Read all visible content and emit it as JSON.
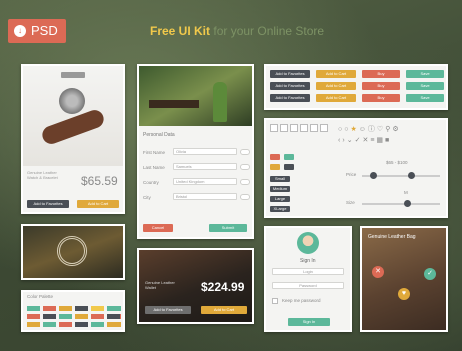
{
  "badge": {
    "label": "PSD"
  },
  "header": {
    "title_strong": "Free UI Kit",
    "title_rest": "for your Online Store"
  },
  "product_card": {
    "price": "$65.59",
    "caption": "Genuine Leather\nWatch & Bracelet",
    "add_to_cart": "Add to Favorites",
    "buy": "Add to Cart"
  },
  "form_card": {
    "section": "Personal Data",
    "rows": [
      {
        "label": "First Name",
        "value": "Olivia"
      },
      {
        "label": "Last Name",
        "value": "Samuels"
      },
      {
        "label": "Country",
        "value": "United Kingdom"
      },
      {
        "label": "City",
        "value": "Bristol"
      }
    ],
    "cancel": "Cancel",
    "submit": "Submit"
  },
  "buttons_card": {
    "rows": [
      [
        "Add to Favorites",
        "Add to Cart",
        "Buy",
        "Save"
      ],
      [
        "Add to Favorites",
        "Add to Cart",
        "Buy",
        "Save"
      ],
      [
        "Add to Favorites",
        "Add to Cart",
        "Buy",
        "Save"
      ]
    ]
  },
  "controls_card": {
    "price_label": "Price",
    "size_label": "Size",
    "price_range": "$65 - $100",
    "size_value": "M",
    "stepper_labels": [
      "Small",
      "Medium",
      "Large",
      "XLarge"
    ]
  },
  "signin_card": {
    "title": "Sign In",
    "login": "Login",
    "password": "Password",
    "remember": "Keep me password",
    "button": "Sign In"
  },
  "wallet_card": {
    "caption": "Genuine Leather\nWallet",
    "price": "$224.99",
    "add": "Add to Favorites",
    "buy": "Add to Cart"
  },
  "color_card": {
    "title": "Color Palette"
  },
  "bag_card": {
    "title": "Genuine Leather Bag"
  },
  "colors": {
    "red": "#dc6a55",
    "orange": "#e0a93a",
    "green": "#5cb89a",
    "dark": "#4a4f56",
    "yellow": "#f1c94b"
  }
}
